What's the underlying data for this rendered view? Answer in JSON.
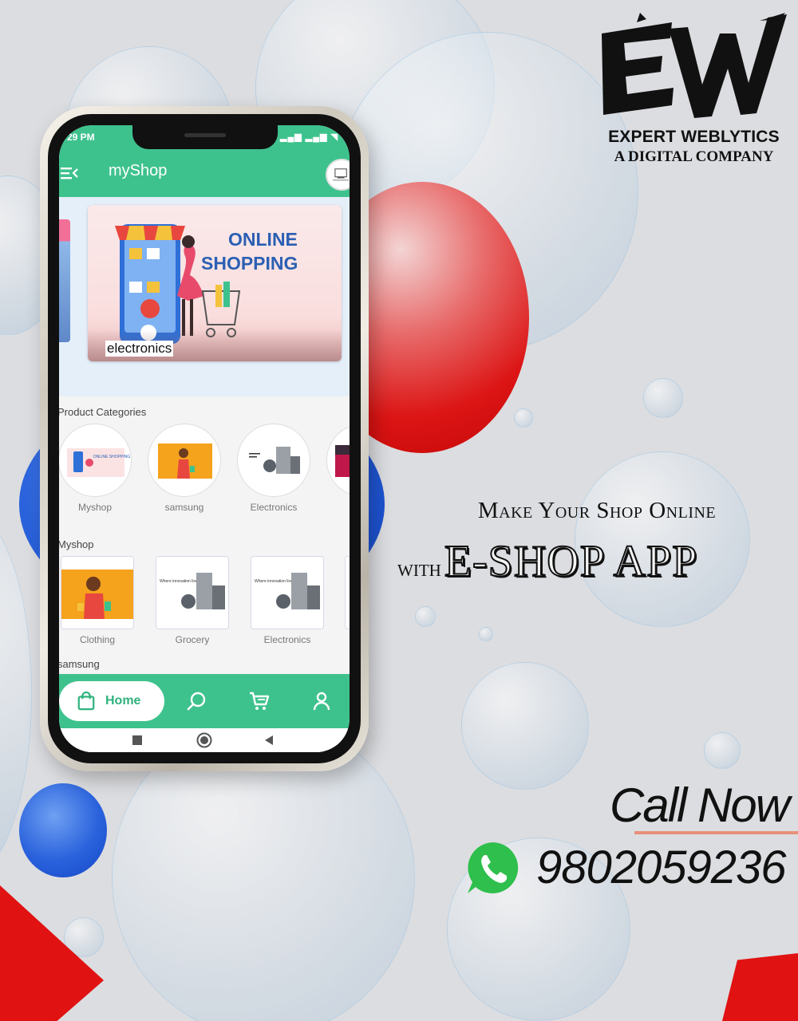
{
  "brand": {
    "logo_letters": "EW",
    "name": "EXPERT WEBLYTICS",
    "tagline": "A DIGITAL COMPANY"
  },
  "headline": {
    "line1": "Make Your Shop Online",
    "with": "with",
    "app_name": "E-Shop App"
  },
  "contact": {
    "call_label": "Call Now",
    "phone": "9802059236",
    "icon": "whatsapp-icon"
  },
  "app": {
    "status_time": "29 PM",
    "status_icons": "▂▄▆ ▂▄▆ ◥",
    "title": "myShop",
    "banner": {
      "heading1": "ONLINE",
      "heading2": "SHOPPING",
      "label": "electronics"
    },
    "sections": {
      "categories_title": "Product Categories",
      "myshop_title": "Myshop",
      "samsung_title": "samsung"
    },
    "categories": [
      {
        "label": "Myshop"
      },
      {
        "label": "samsung"
      },
      {
        "label": "Electronics"
      }
    ],
    "myshop_items": [
      {
        "label": "Clothing"
      },
      {
        "label": "Grocery"
      },
      {
        "label": "Electronics"
      }
    ],
    "thumb_text": {
      "online_shopping": "ONLINE SHOPPING",
      "innovation": "Where innovation lives"
    },
    "nav": {
      "home_label": "Home",
      "icons": [
        "shopping-bag-icon",
        "search-icon",
        "cart-icon",
        "user-icon"
      ]
    }
  },
  "colors": {
    "app_green": "#3ec28d",
    "accent_red": "#dc1414",
    "accent_blue": "#1447c8",
    "whatsapp_green": "#2fbf4c"
  }
}
